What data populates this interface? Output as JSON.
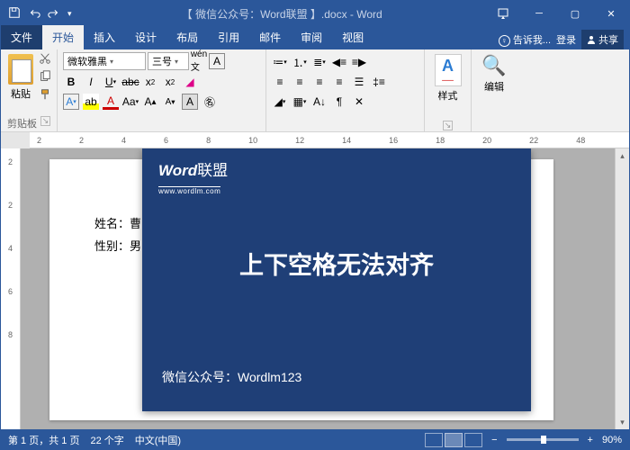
{
  "title": "【 微信公众号：Word联盟 】.docx - Word",
  "tabs": {
    "file": "文件",
    "home": "开始",
    "insert": "插入",
    "design": "设计",
    "layout": "布局",
    "ref": "引用",
    "mail": "邮件",
    "review": "审阅",
    "view": "视图"
  },
  "tell_me": "告诉我...",
  "login": "登录",
  "share": "共享",
  "ribbon": {
    "paste": "粘贴",
    "clipboard": "剪贴板",
    "font_name": "微软雅黑",
    "font_size": "三号",
    "styles": "样式",
    "edit": "编辑"
  },
  "ruler_h": [
    "2",
    "2",
    "4",
    "6",
    "8",
    "10",
    "12",
    "14",
    "16",
    "18",
    "20",
    "22",
    "48"
  ],
  "ruler_v": [
    "2",
    "2",
    "4",
    "6",
    "8"
  ],
  "doc": {
    "line1": "姓名：曹",
    "line2": "性别：男"
  },
  "overlay": {
    "logo1": "Word",
    "logo2": "联盟",
    "url": "www.wordlm.com",
    "title": "上下空格无法对齐",
    "sub": "微信公众号：Wordlm123"
  },
  "status": {
    "page": "第 1 页，共 1 页",
    "words": "22 个字",
    "lang": "中文(中国)",
    "zoom": "90%"
  }
}
